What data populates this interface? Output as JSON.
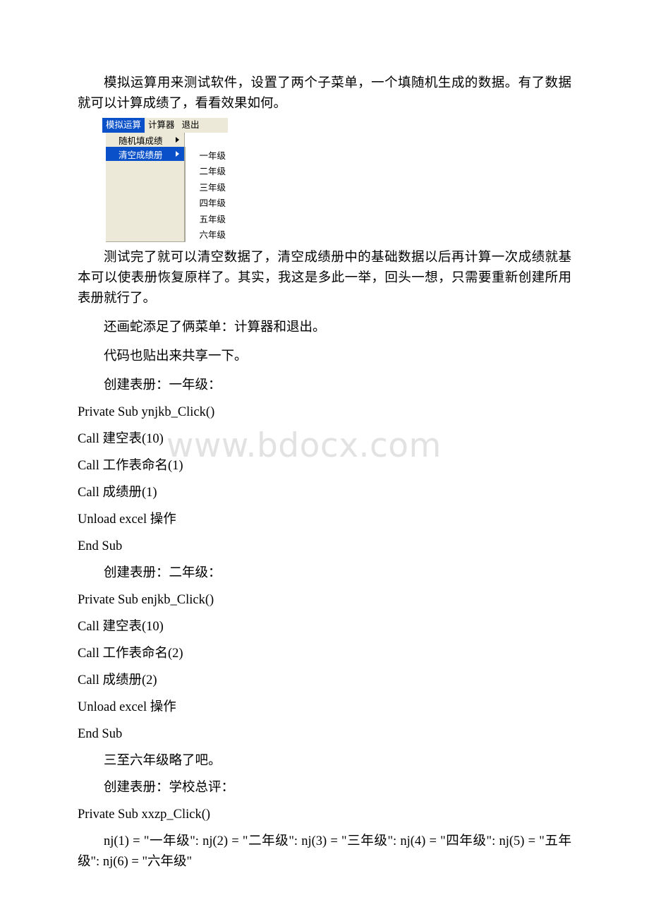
{
  "document": {
    "watermark": "www.bdocx.com"
  },
  "paragraphs": {
    "p1": "模拟运算用来测试软件，设置了两个子菜单，一个填随机生成的数据。有了数据就可以计算成绩了，看看效果如何。",
    "p2": "测试完了就可以清空数据了，清空成绩册中的基础数据以后再计算一次成绩就基本可以使表册恢复原样了。其实，我这是多此一举，回头一想，只需要重新创建所用表册就行了。",
    "p3": "还画蛇添足了俩菜单：计算器和退出。",
    "p4": "代码也贴出来共享一下。"
  },
  "menu_screenshot": {
    "menubar": [
      {
        "label": "模拟运算",
        "active": true
      },
      {
        "label": "计算器",
        "active": false
      },
      {
        "label": "退出",
        "active": false
      }
    ],
    "dropdown": [
      {
        "label": "随机填成绩",
        "selected": false,
        "has_submenu": true
      },
      {
        "label": "清空成绩册",
        "selected": true,
        "has_submenu": true
      }
    ],
    "submenu": [
      "一年级",
      "二年级",
      "三年级",
      "四年级",
      "五年级",
      "六年级"
    ],
    "colors": {
      "highlight": "#0a50c8",
      "panel": "#ece9d8",
      "submenu_panel": "#ffffff",
      "border": "#aca899"
    }
  },
  "code_sections": {
    "s1": {
      "heading": "创建表册：一年级：",
      "lines": [
        "Private Sub ynjkb_Click()",
        "Call 建空表(10)",
        "Call 工作表命名(1)",
        "Call 成绩册(1)",
        "Unload excel 操作",
        "End Sub"
      ]
    },
    "s2": {
      "heading": "创建表册：二年级：",
      "lines": [
        "Private Sub enjkb_Click()",
        "Call 建空表(10)",
        "Call 工作表命名(2)",
        "Call 成绩册(2)",
        "Unload excel 操作",
        "End Sub"
      ]
    },
    "note": "三至六年级略了吧。",
    "s3": {
      "heading": "创建表册：学校总评：",
      "lines": [
        "Private Sub xxzp_Click()"
      ],
      "array_line": "nj(1) = \"一年级\": nj(2) = \"二年级\": nj(3) = \"三年级\": nj(4) = \"四年级\": nj(5) = \"五年级\": nj(6) = \"六年级\""
    }
  }
}
